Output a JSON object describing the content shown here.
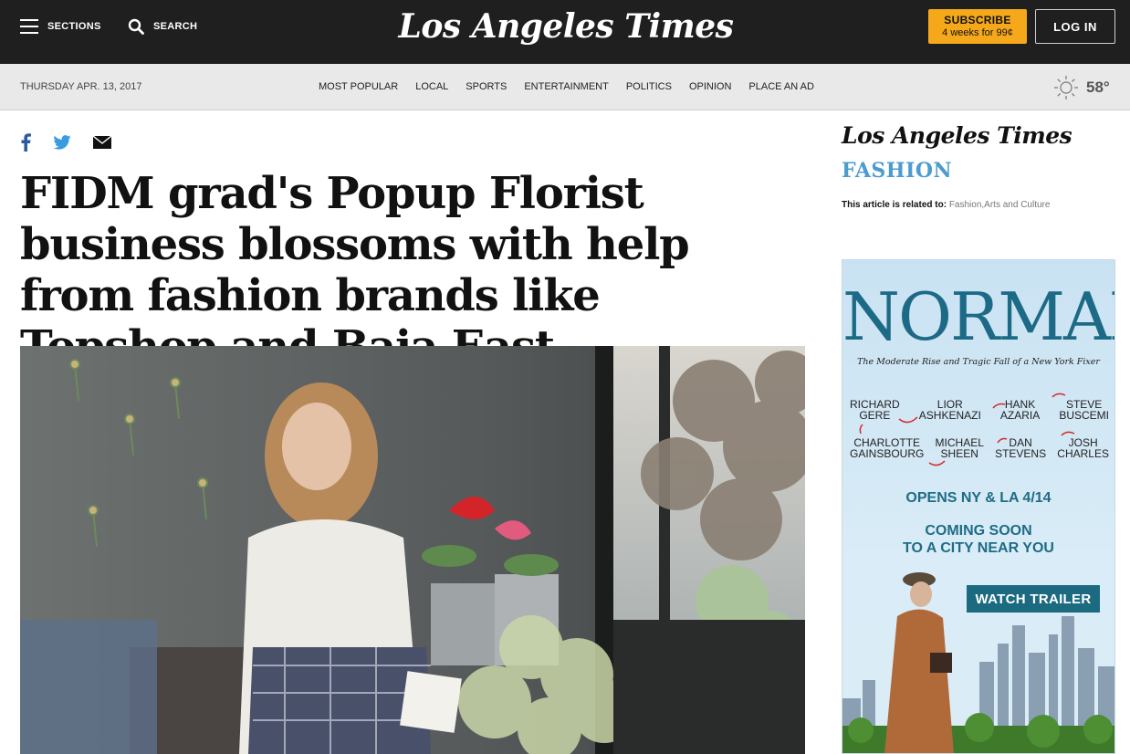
{
  "header": {
    "sections_label": "SECTIONS",
    "search_label": "SEARCH",
    "masthead": "Los Angeles Times",
    "subscribe_label": "SUBSCRIBE",
    "subscribe_offer": "4 weeks for 99¢",
    "login_label": "LOG IN"
  },
  "subnav": {
    "date": "THURSDAY APR. 13, 2017",
    "items": [
      "MOST POPULAR",
      "LOCAL",
      "SPORTS",
      "ENTERTAINMENT",
      "POLITICS",
      "OPINION",
      "PLACE AN AD"
    ],
    "weather_icon": "sun-icon",
    "temperature": "58°"
  },
  "article": {
    "share_icons": [
      "facebook-icon",
      "twitter-icon",
      "email-icon"
    ],
    "headline": "FIDM grad's Popup Florist business blossoms with help from fashion brands like Topshop and Baja East"
  },
  "sidebar": {
    "logo": "Los Angeles Times",
    "section": "FASHION",
    "related_label": "This article is related to:",
    "related_tags": "Fashion,Arts and Culture"
  },
  "ad": {
    "title": "NORMAN",
    "tagline": "The Moderate Rise and Tragic Fall of a New York Fixer",
    "cast_row1": [
      "RICHARD\nGERE",
      "LIOR\nASHKENAZI",
      "HANK\nAZARIA",
      "STEVE\nBUSCEMI"
    ],
    "cast_row2": [
      "CHARLOTTE\nGAINSBOURG",
      "MICHAEL\nSHEEN",
      "DAN\nSTEVENS",
      "JOSH\nCHARLES"
    ],
    "opens": "OPENS NY & LA 4/14",
    "coming_soon": "COMING SOON\nTO A CITY NEAR YOU",
    "button_label": "WATCH TRAILER"
  },
  "colors": {
    "header_bg": "#1f1f1f",
    "subscribe_bg": "#f5a81a",
    "fashion_blue": "#4c9ccf",
    "ad_teal": "#1b6a80"
  }
}
